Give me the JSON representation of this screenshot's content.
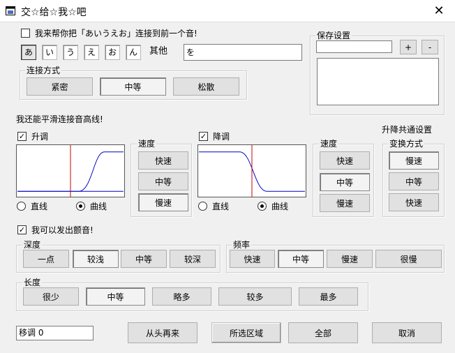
{
  "window": {
    "title": "交☆给☆我☆吧",
    "close_label": "✕"
  },
  "connect": {
    "checkbox_label": "我来帮你把「あいうえお」连接到前一个音!",
    "kana": [
      "あ",
      "い",
      "う",
      "え",
      "お",
      "ん"
    ],
    "other_label": "其他",
    "other_value": "を",
    "method_label": "连接方式",
    "method_buttons": [
      "紧密",
      "中等",
      "松散"
    ]
  },
  "saved": {
    "label": "保存设置",
    "plus_label": "+",
    "minus_label": "-"
  },
  "smooth": {
    "heading": "我还能平滑连接音高线!",
    "common_heading": "升降共通设置"
  },
  "rise": {
    "checkbox_label": "升调",
    "speed_label": "速度",
    "speed_buttons": [
      "快速",
      "中等",
      "慢速"
    ],
    "radio_line": "直线",
    "radio_curve": "曲线"
  },
  "fall": {
    "checkbox_label": "降调",
    "speed_label": "速度",
    "speed_buttons": [
      "快速",
      "中等",
      "慢速"
    ],
    "radio_line": "直线",
    "radio_curve": "曲线"
  },
  "transform": {
    "label": "变换方式",
    "buttons": [
      "慢速",
      "中等",
      "快速"
    ]
  },
  "vibrato": {
    "checkbox_label": "我可以发出颤音!",
    "depth_label": "深度",
    "depth_buttons": [
      "一点",
      "较浅",
      "中等",
      "较深"
    ],
    "freq_label": "频率",
    "freq_buttons": [
      "快速",
      "中等",
      "慢速",
      "很慢"
    ],
    "length_label": "长度",
    "length_buttons": [
      "很少",
      "中等",
      "略多",
      "较多",
      "最多"
    ]
  },
  "footer": {
    "transpose_value": "移调 0",
    "buttons": [
      "从头再来",
      "所选区域",
      "全部",
      "取消"
    ]
  }
}
